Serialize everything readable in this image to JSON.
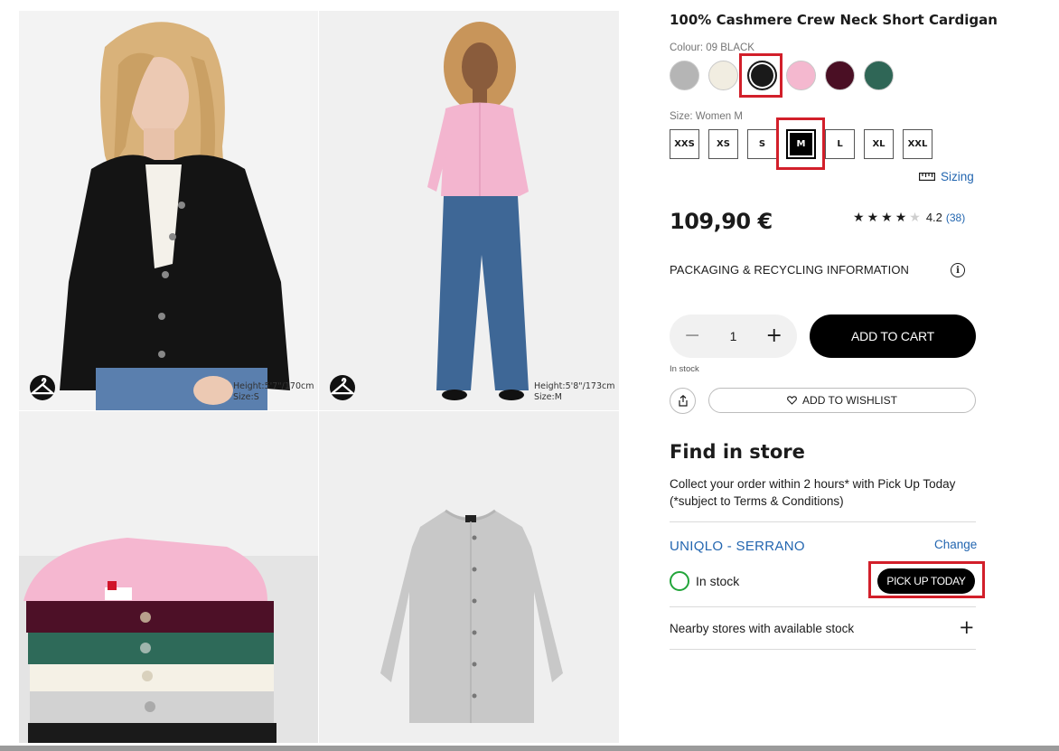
{
  "gallery": {
    "image1": {
      "model_height": "Height:5'7\"/170cm",
      "model_size": "Size:S"
    },
    "image2": {
      "model_height": "Height:5'8\"/173cm",
      "model_size": "Size:M"
    },
    "icons": {
      "try_on": "hanger-icon"
    }
  },
  "product": {
    "title": "100% Cashmere Crew Neck Short Cardigan",
    "colour_label": "Colour: 09 BLACK",
    "swatches": [
      {
        "name": "gray",
        "color": "#b5b5b5"
      },
      {
        "name": "off-white",
        "color": "#f1ede1"
      },
      {
        "name": "black",
        "color": "#1a1a1a",
        "selected": true
      },
      {
        "name": "pink",
        "color": "#f4b8cf"
      },
      {
        "name": "wine",
        "color": "#4a0f24"
      },
      {
        "name": "green",
        "color": "#2f6656"
      }
    ],
    "size_label": "Size: Women M",
    "sizes": [
      "XXS",
      "XS",
      "S",
      "M",
      "L",
      "XL",
      "XXL"
    ],
    "selected_size": "M",
    "sizing_link": "Sizing",
    "price": "109,90 €",
    "rating": {
      "stars": 4,
      "max": 5,
      "value": "4.2",
      "count": "(38)"
    },
    "packaging_info": "PACKAGING & RECYCLING INFORMATION",
    "quantity": "1",
    "add_to_cart": "ADD TO CART",
    "stock_note": "In stock",
    "wishlist": "ADD TO WISHLIST"
  },
  "store": {
    "title": "Find in store",
    "collect_text": "Collect your order within 2 hours* with Pick Up Today (*subject to Terms & Conditions)",
    "store_name": "UNIQLO - SERRANO",
    "change": "Change",
    "stock_status": "In stock",
    "pickup_button": "PICK UP TODAY",
    "nearby": "Nearby stores with available stock"
  },
  "colors": {
    "accent_link": "#2366b0",
    "stock_green": "#22a53a",
    "highlight_red": "#d21f2a"
  }
}
